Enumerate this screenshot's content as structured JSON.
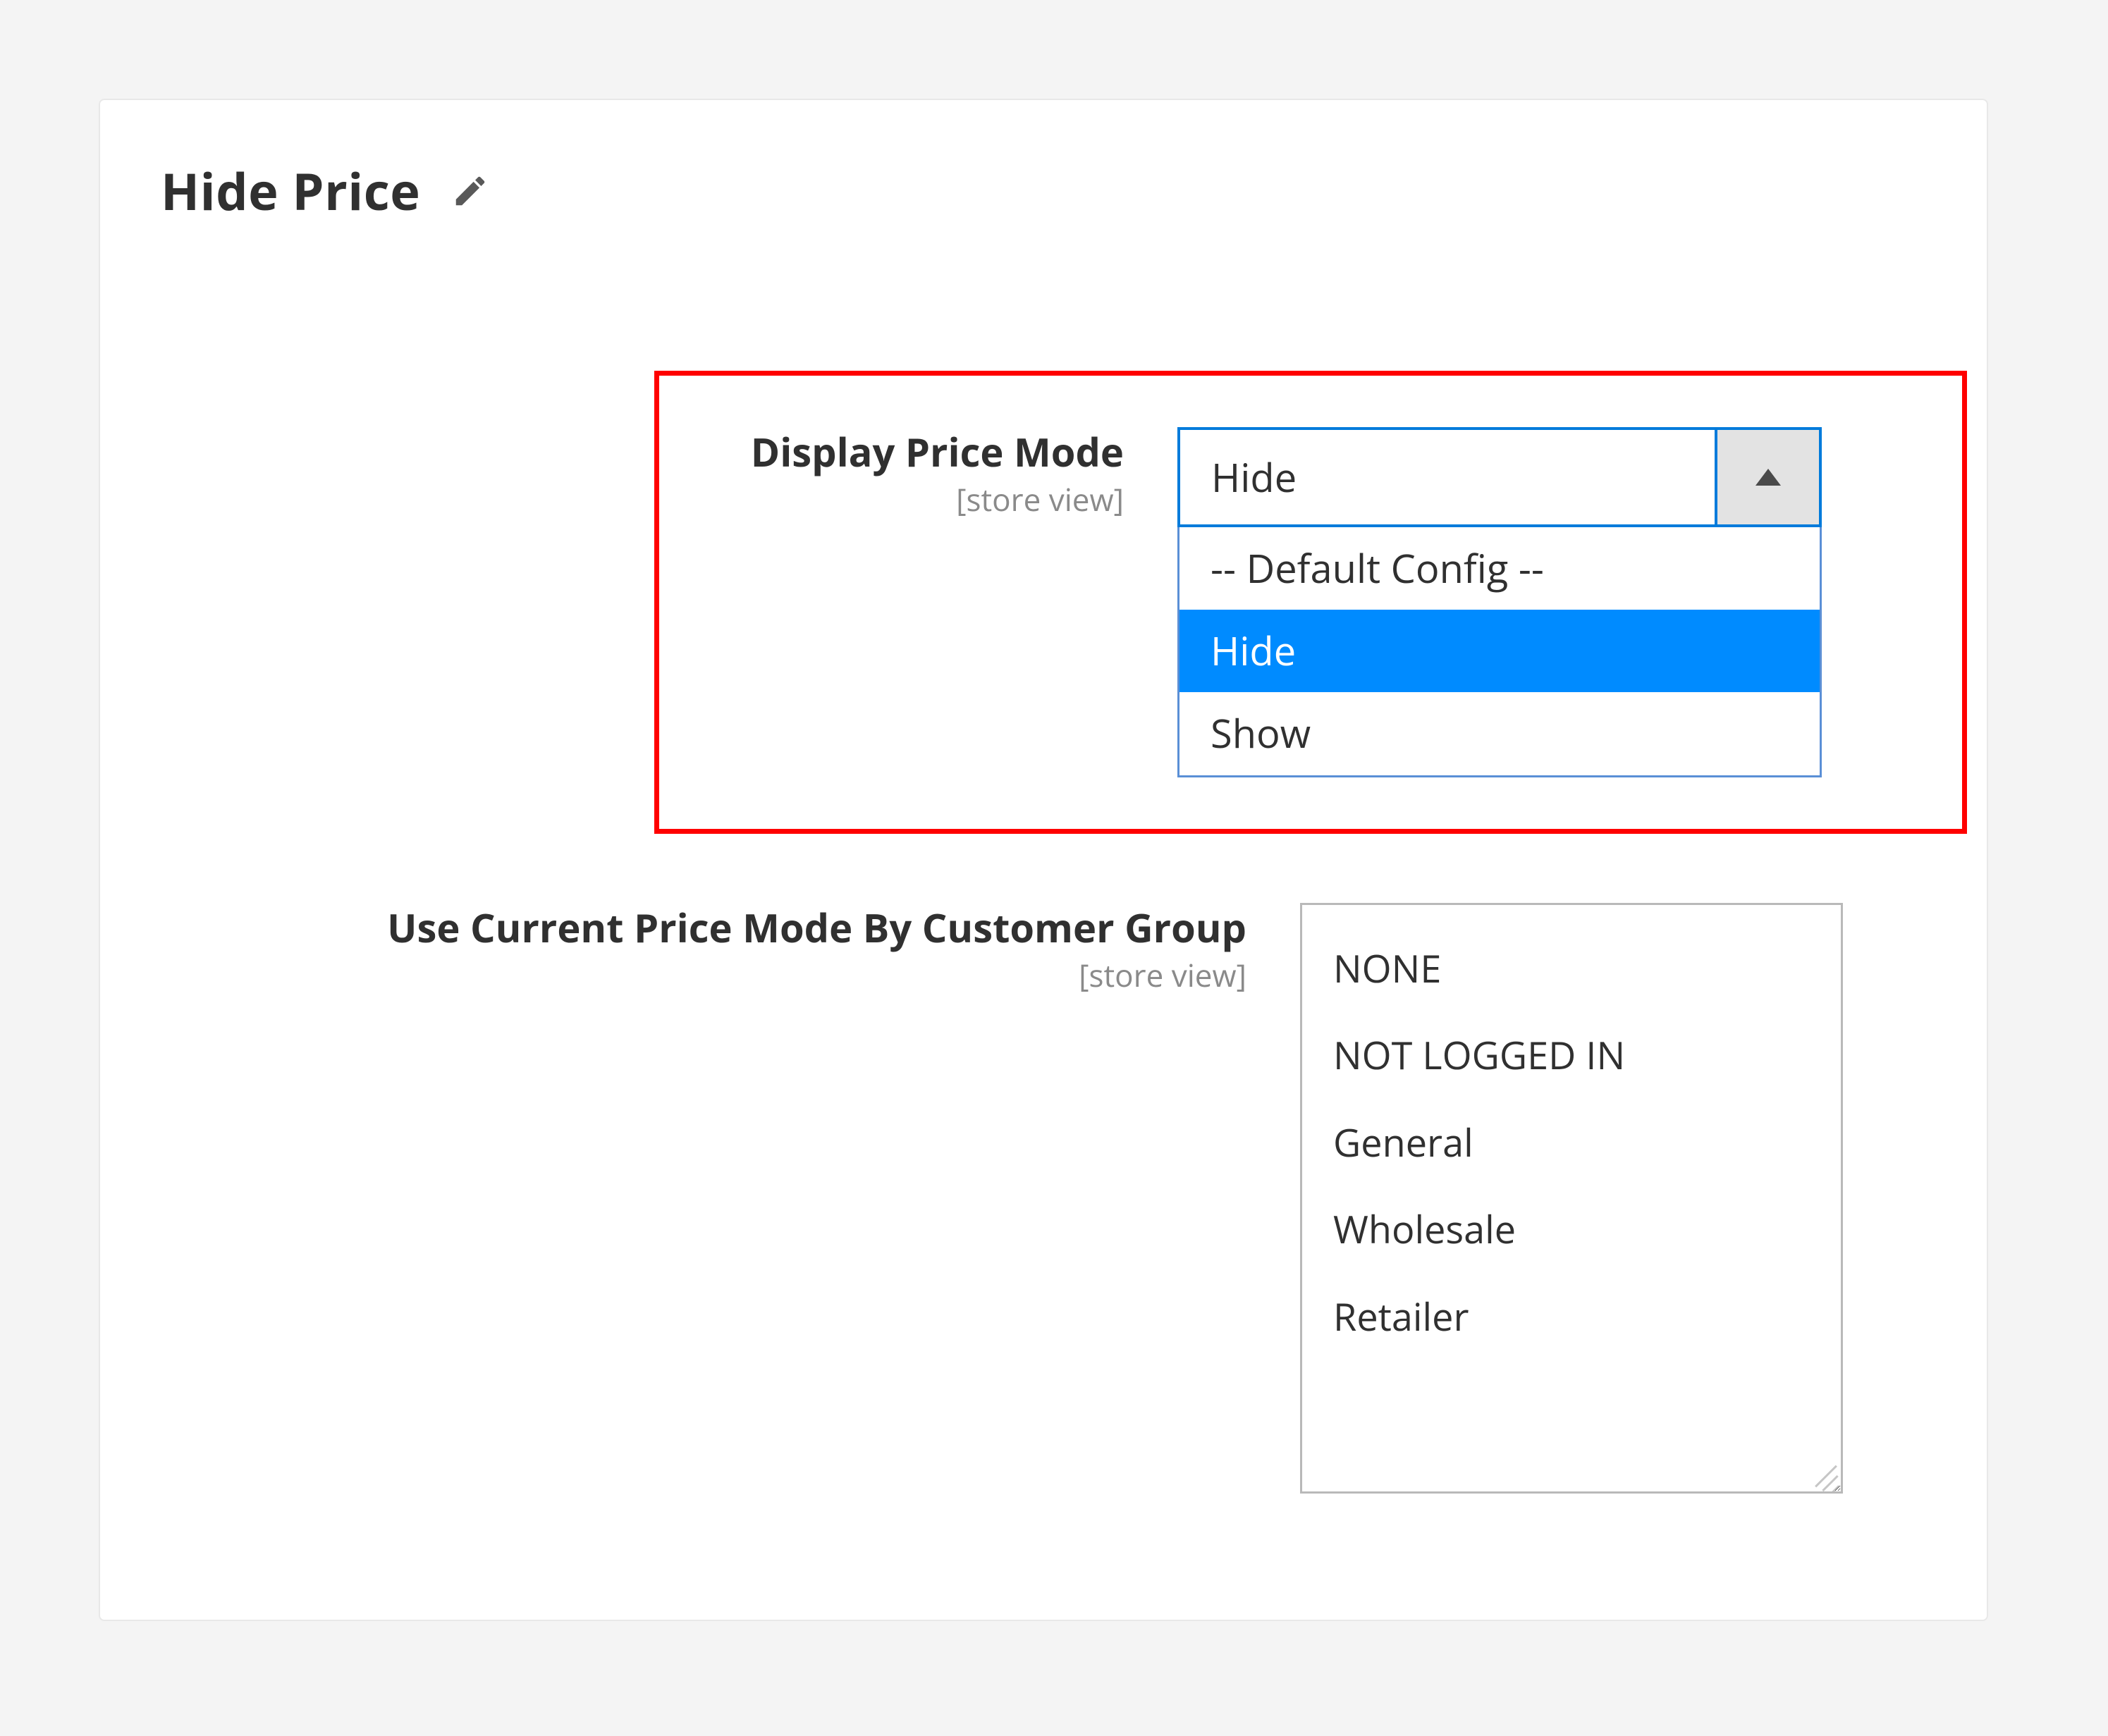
{
  "section": {
    "title": "Hide Price"
  },
  "scopeLabel": "[store view]",
  "fields": {
    "displayPriceMode": {
      "label": "Display Price Mode",
      "value": "Hide",
      "options": [
        "-- Default Config --",
        "Hide",
        "Show"
      ],
      "selectedIndex": 1
    },
    "customerGroup": {
      "label": "Use Current Price Mode By Customer Group",
      "options": [
        "NONE",
        "NOT LOGGED IN",
        "General",
        "Wholesale",
        "Retailer"
      ]
    }
  },
  "colors": {
    "highlight": "#ff0000",
    "focusBorder": "#007bdb",
    "selectionBg": "#008bff"
  }
}
